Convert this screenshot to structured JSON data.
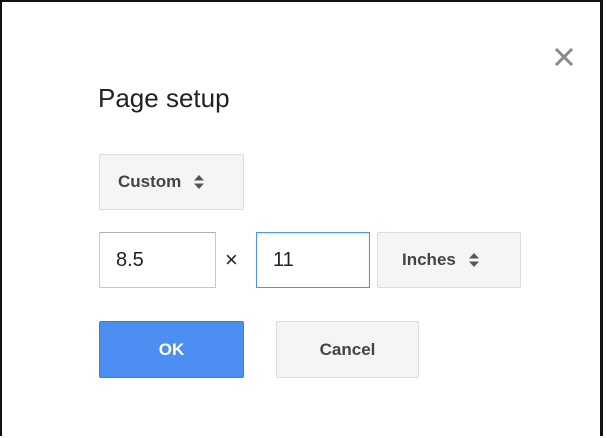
{
  "dialog": {
    "title": "Page setup",
    "close_icon": "close-icon",
    "preset": {
      "selected": "Custom",
      "icon": "up-down-arrows-icon"
    },
    "size": {
      "width_value": "8.5",
      "separator": "×",
      "height_value": "11",
      "units_selected": "Inches",
      "units_icon": "up-down-arrows-icon"
    },
    "buttons": {
      "ok_label": "OK",
      "cancel_label": "Cancel"
    },
    "colors": {
      "ok_blue": "#4d8ef3",
      "focus_border": "#4d90fe"
    }
  }
}
